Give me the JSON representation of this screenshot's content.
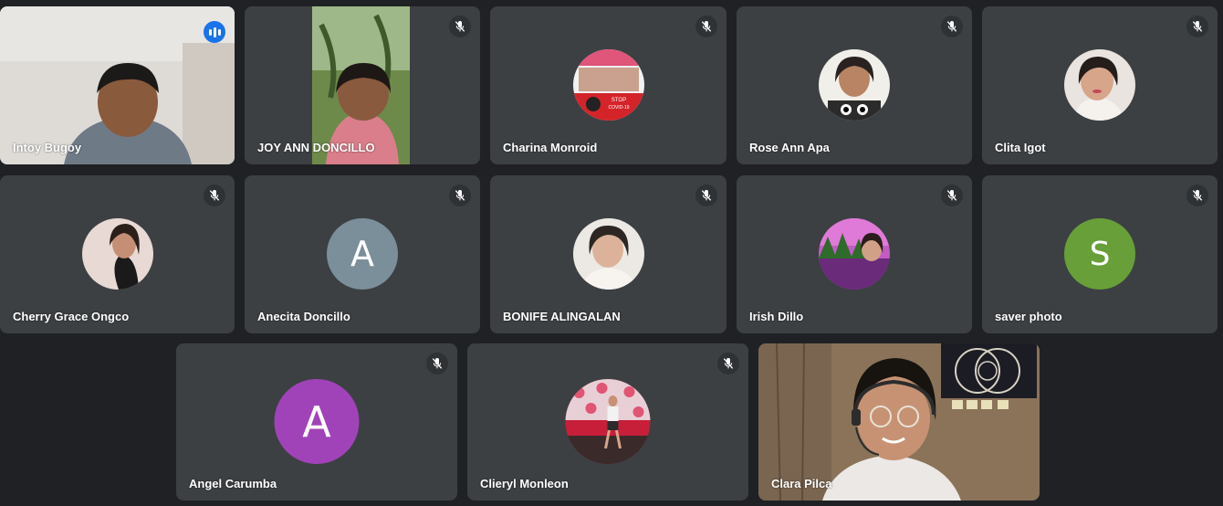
{
  "participants": [
    {
      "name": "Intoy Bugoy",
      "status": "speaking"
    },
    {
      "name": "JOY ANN DONCILLO",
      "status": "muted"
    },
    {
      "name": "Charina Monroid",
      "status": "muted",
      "avatar_text": [
        "STOP",
        "COVID-19"
      ]
    },
    {
      "name": "Rose Ann Apa",
      "status": "muted"
    },
    {
      "name": "Clita Igot",
      "status": "muted"
    },
    {
      "name": "Cherry Grace Ongco",
      "status": "muted"
    },
    {
      "name": "Anecita Doncillo",
      "status": "muted",
      "initial": "A",
      "color": "#7b8f9a"
    },
    {
      "name": "BONIFE ALINGALAN",
      "status": "muted"
    },
    {
      "name": "Irish Dillo",
      "status": "muted"
    },
    {
      "name": "saver photo",
      "status": "muted",
      "initial": "S",
      "color": "#689f38"
    },
    {
      "name": "Angel Carumba",
      "status": "muted",
      "initial": "A",
      "color": "#a143b8"
    },
    {
      "name": "Clieryl Monleon",
      "status": "muted"
    },
    {
      "name": "Clara Pilca",
      "status": "video"
    }
  ],
  "icons": {
    "mute": "mic-off-icon",
    "speaking": "audio-level-icon"
  },
  "colors": {
    "background": "#202124",
    "tile": "#3c4043",
    "active_border": "#4f8ef7",
    "speaking_badge": "#1a73e8"
  }
}
